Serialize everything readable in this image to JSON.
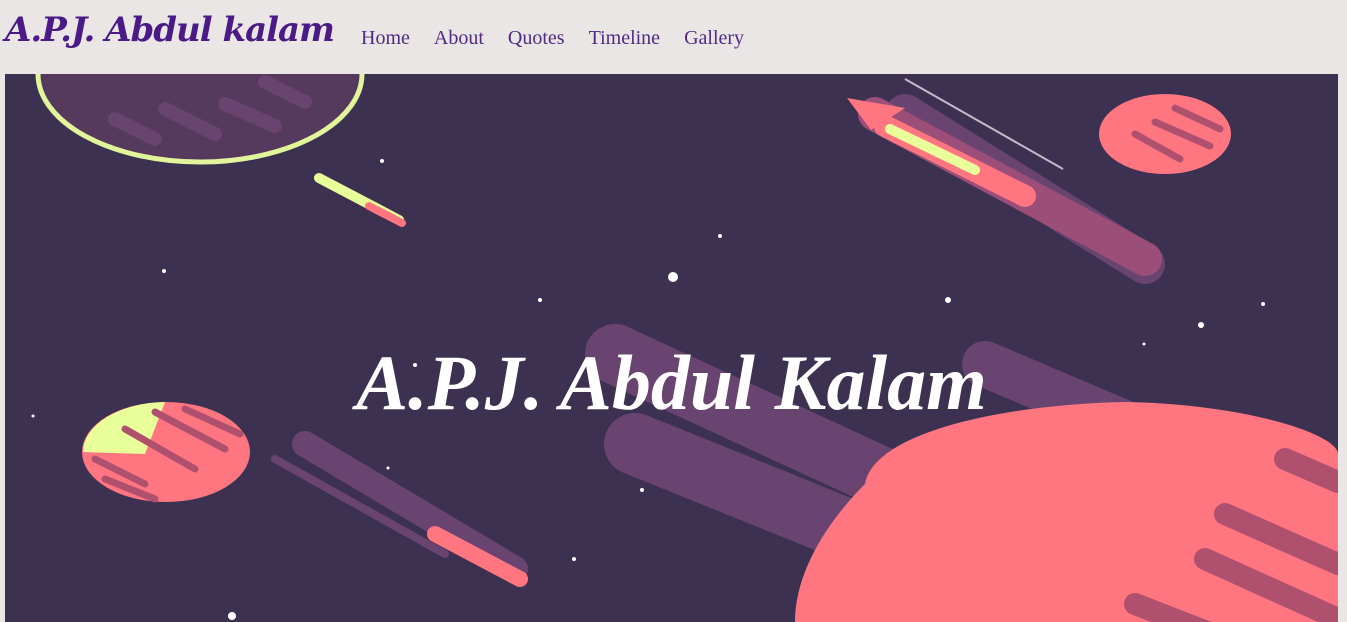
{
  "brand": {
    "title": "A.P.J. Abdul kalam"
  },
  "nav": {
    "items": [
      {
        "label": "Home"
      },
      {
        "label": "About"
      },
      {
        "label": "Quotes"
      },
      {
        "label": "Timeline"
      },
      {
        "label": "Gallery"
      }
    ]
  },
  "hero": {
    "title": "A.P.J. Abdul Kalam",
    "background_image": "space-illustration"
  },
  "colors": {
    "brand": "#4a1a86",
    "nav_link": "#4f2a82",
    "navbar_bg": "#ebe6e6",
    "hero_bg": "#3c3150",
    "planet_pink": "#ff7681",
    "streak_purple": "#6a4470",
    "accent_yellow": "#e8ff9a"
  }
}
